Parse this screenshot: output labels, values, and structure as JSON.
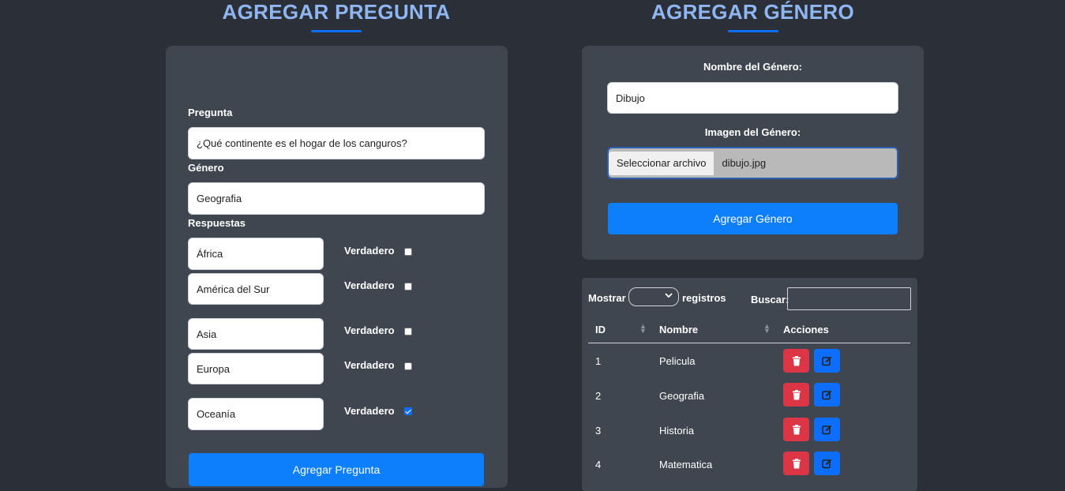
{
  "left": {
    "title": "AGREGAR PREGUNTA",
    "pregunta_label": "Pregunta",
    "pregunta_value": "¿Qué continente es el hogar de los canguros?",
    "genero_label": "Género",
    "genero_value": "Geografia",
    "respuestas_label": "Respuestas",
    "respuestas": [
      {
        "value": "África",
        "label": "Verdadero",
        "checked": false
      },
      {
        "value": "América del Sur",
        "label": "Verdadero",
        "checked": false
      },
      {
        "value": "Asia",
        "label": "Verdadero",
        "checked": false
      },
      {
        "value": "Europa",
        "label": "Verdadero",
        "checked": false
      },
      {
        "value": "Oceanía",
        "label": "Verdadero",
        "checked": true
      }
    ],
    "submit_label": "Agregar Pregunta"
  },
  "right": {
    "title": "AGREGAR GÉNERO",
    "nombre_label": "Nombre del Género:",
    "nombre_value": "Dibujo",
    "imagen_label": "Imagen del Género:",
    "file_button": "Seleccionar archivo",
    "file_name": "dibujo.jpg",
    "submit_label": "Agregar Género"
  },
  "table": {
    "mostrar": "Mostrar",
    "registros": "registros",
    "buscar": "Buscar:",
    "headers": [
      "ID",
      "Nombre",
      "Acciones"
    ],
    "rows": [
      {
        "id": "1",
        "nombre": "Pelicula"
      },
      {
        "id": "2",
        "nombre": "Geografia"
      },
      {
        "id": "3",
        "nombre": "Historia"
      },
      {
        "id": "4",
        "nombre": "Matematica"
      }
    ]
  },
  "colors": {
    "accent": "#0d6efd",
    "title": "#8fb6f0",
    "danger": "#dc3545",
    "card": "#3f4650",
    "background": "#2b3038"
  },
  "icons": [
    "trash-icon",
    "edit-icon",
    "chevron-down-icon",
    "sort-icon"
  ]
}
